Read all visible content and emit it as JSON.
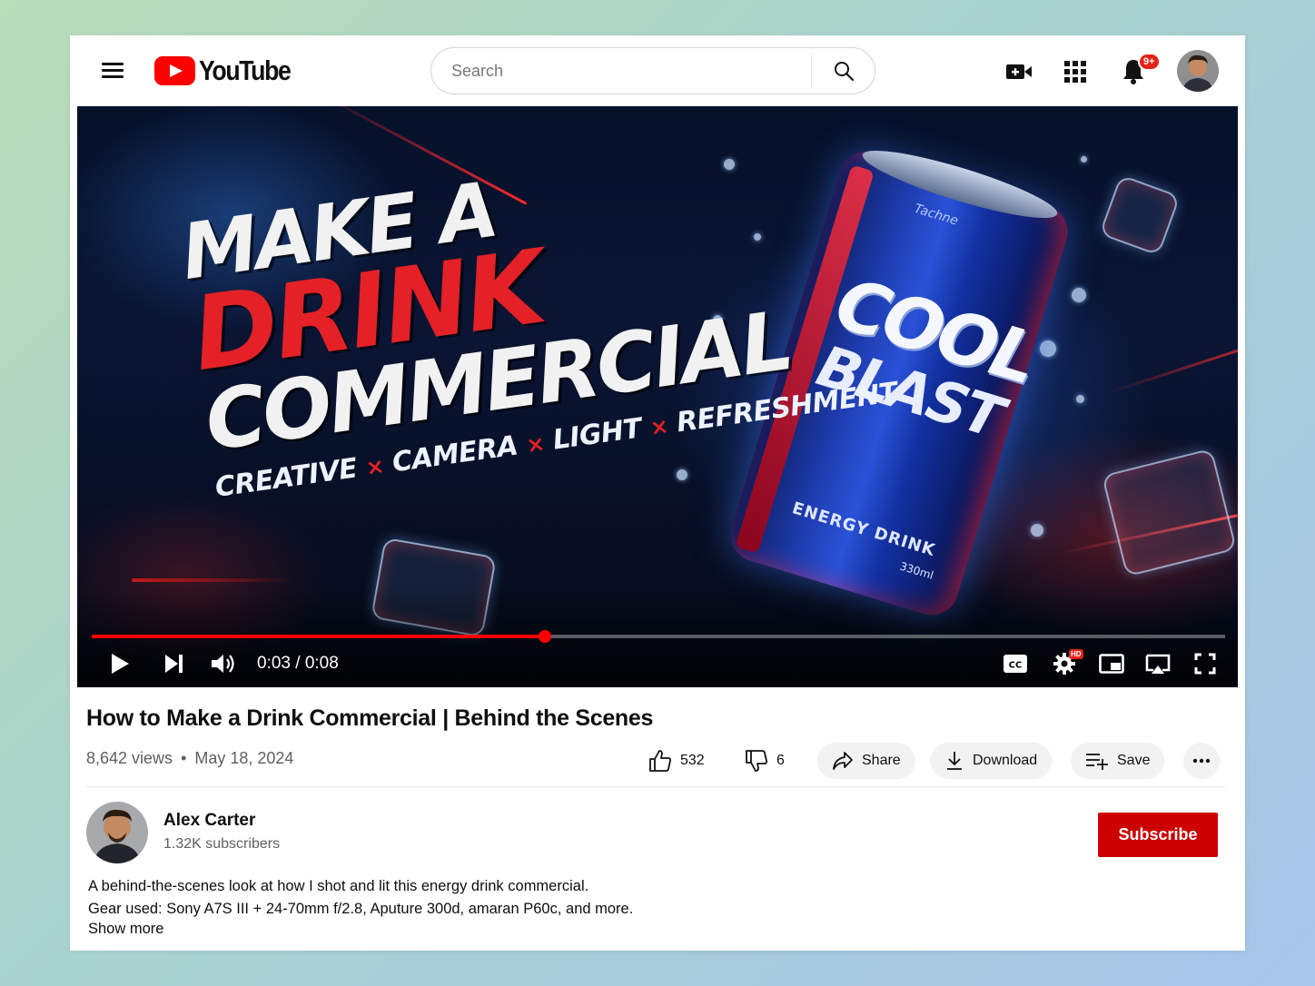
{
  "header": {
    "logo_text": "YouTube",
    "search_placeholder": "Search",
    "notifications_badge": "9+"
  },
  "player": {
    "thumbnail": {
      "headline_1": "MAKE A",
      "headline_2": "DRINK",
      "headline_3": "COMMERCIAL",
      "tagline": [
        "CREATIVE",
        "CAMERA",
        "LIGHT",
        "REFRESHMENT"
      ],
      "tagline_separator": "×",
      "can_brand": "Tachne",
      "can_line_1": "COOL",
      "can_line_2": "BLAST",
      "can_line_3": "ENERGY DRINK",
      "can_volume": "330ml"
    },
    "time_display": "0:03 / 0:08",
    "progress_fraction": 0.4,
    "cc_label": "CC",
    "hd_badge": "HD"
  },
  "video": {
    "title": "How to Make a Drink Commercial | Behind the Scenes",
    "views": "8,642 views",
    "date": "May 18, 2024",
    "separator": "•",
    "likes": "532",
    "dislikes": "6",
    "share_label": "Share",
    "download_label": "Download",
    "save_label": "Save"
  },
  "channel": {
    "name": "Alex Carter",
    "subscribers": "1.32K subscribers",
    "subscribe_label": "Subscribe"
  },
  "description": {
    "line_1": "A behind-the-scenes look at how I shot and lit this energy drink commercial.",
    "line_2": "Gear used: Sony A7S III + 24-70mm f/2.8, Aputure 300d, amaran P60c, and more.",
    "show_more": "Show more"
  },
  "colors": {
    "brand_red": "#ff0000",
    "subscribe_red": "#cc0000",
    "progress_red": "#ff0000"
  },
  "icons": [
    "menu-icon",
    "youtube-logo-icon",
    "search-icon",
    "create-video-icon",
    "apps-grid-icon",
    "bell-icon",
    "play-icon",
    "next-icon",
    "volume-icon",
    "captions-icon",
    "settings-icon",
    "miniplayer-icon",
    "cast-icon",
    "fullscreen-icon",
    "thumbs-up-icon",
    "thumbs-down-icon",
    "share-icon",
    "download-icon",
    "save-playlist-icon",
    "more-icon"
  ]
}
